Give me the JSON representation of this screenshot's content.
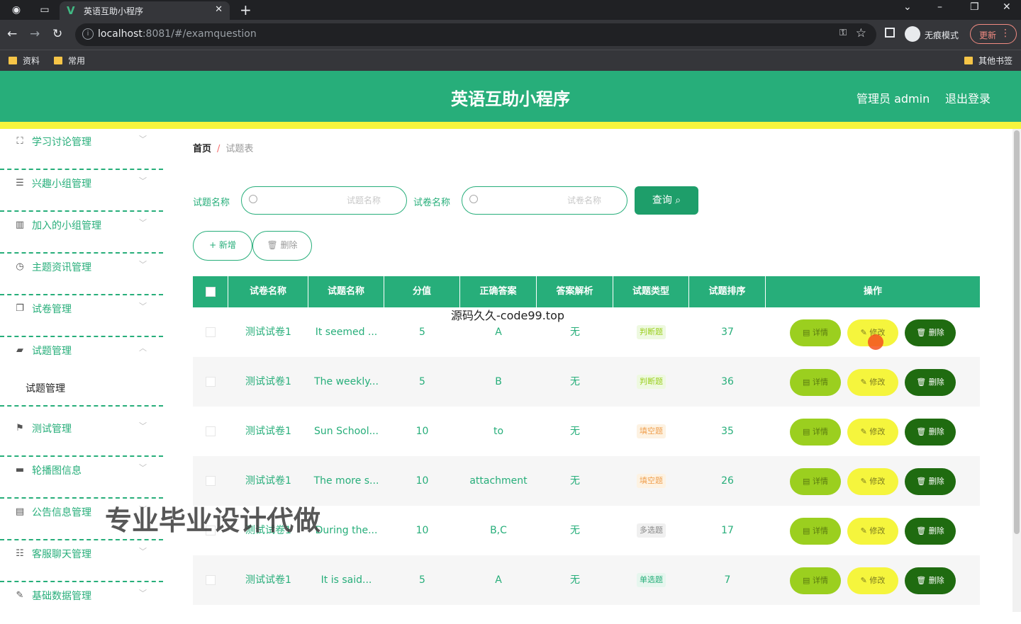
{
  "browser": {
    "tab_title": "英语互助小程序",
    "url_host": "localhost",
    "url_path": ":8081/#/examquestion",
    "incognito_label": "无痕模式",
    "update_label": "更新",
    "bookmarks": [
      "资料",
      "常用"
    ],
    "other_bookmarks": "其他书签"
  },
  "header": {
    "title": "英语互助小程序",
    "user": "管理员 admin",
    "logout": "退出登录"
  },
  "sidebar": {
    "items": [
      {
        "label": "学习讨论管理",
        "icon": "expand-icon"
      },
      {
        "label": "兴趣小组管理",
        "icon": "list-icon"
      },
      {
        "label": "加入的小组管理",
        "icon": "books-icon"
      },
      {
        "label": "主题资讯管理",
        "icon": "clock-icon"
      },
      {
        "label": "试卷管理",
        "icon": "copy-icon"
      },
      {
        "label": "试题管理",
        "icon": "chat-icon"
      },
      {
        "label": "测试管理",
        "icon": "flag-icon"
      },
      {
        "label": "轮播图信息",
        "icon": "monitor-icon"
      },
      {
        "label": "公告信息管理",
        "icon": "message-icon"
      },
      {
        "label": "客服聊天管理",
        "icon": "sliders-icon"
      },
      {
        "label": "基础数据管理",
        "icon": "edit-icon"
      }
    ],
    "submenu_item": "试题管理"
  },
  "breadcrumb": {
    "home": "首页",
    "separator": "/",
    "current": "试题表"
  },
  "filters": {
    "question_label": "试题名称",
    "question_placeholder": "试题名称",
    "paper_label": "试卷名称",
    "paper_placeholder": "试卷名称",
    "query_label": "查询"
  },
  "toolbar": {
    "add_label": "+ 新增",
    "delete_label": "删除"
  },
  "table": {
    "headers": [
      "试卷名称",
      "试题名称",
      "分值",
      "正确答案",
      "答案解析",
      "试题类型",
      "试题排序",
      "操作"
    ],
    "action_labels": {
      "detail": "详情",
      "edit": "修改",
      "remove": "删除"
    },
    "rows": [
      {
        "paper": "测试试卷1",
        "question": "It seemed ...",
        "score": "5",
        "answer": "A",
        "analysis": "无",
        "type": "判断题",
        "order": "37"
      },
      {
        "paper": "测试试卷1",
        "question": "The weekly...",
        "score": "5",
        "answer": "B",
        "analysis": "无",
        "type": "判断题",
        "order": "36"
      },
      {
        "paper": "测试试卷1",
        "question": "Sun School...",
        "score": "10",
        "answer": "to",
        "analysis": "无",
        "type": "填空题",
        "order": "35"
      },
      {
        "paper": "测试试卷1",
        "question": "The more s...",
        "score": "10",
        "answer": "attachment",
        "analysis": "无",
        "type": "填空题",
        "order": "26"
      },
      {
        "paper": "测试试卷1",
        "question": "During the...",
        "score": "10",
        "answer": "B,C",
        "analysis": "无",
        "type": "多选题",
        "order": "17"
      },
      {
        "paper": "测试试卷1",
        "question": "It is said...",
        "score": "5",
        "answer": "A",
        "analysis": "无",
        "type": "单选题",
        "order": "7"
      }
    ]
  },
  "overlays": {
    "site_text": "源码久久-code99.top",
    "promo_text": "专业毕业设计代做"
  },
  "colors": {
    "primary": "#27ae7a",
    "accent_yellow": "#f5f53d",
    "detail_green": "#9bcf1f",
    "dark_green": "#1f6b10"
  }
}
